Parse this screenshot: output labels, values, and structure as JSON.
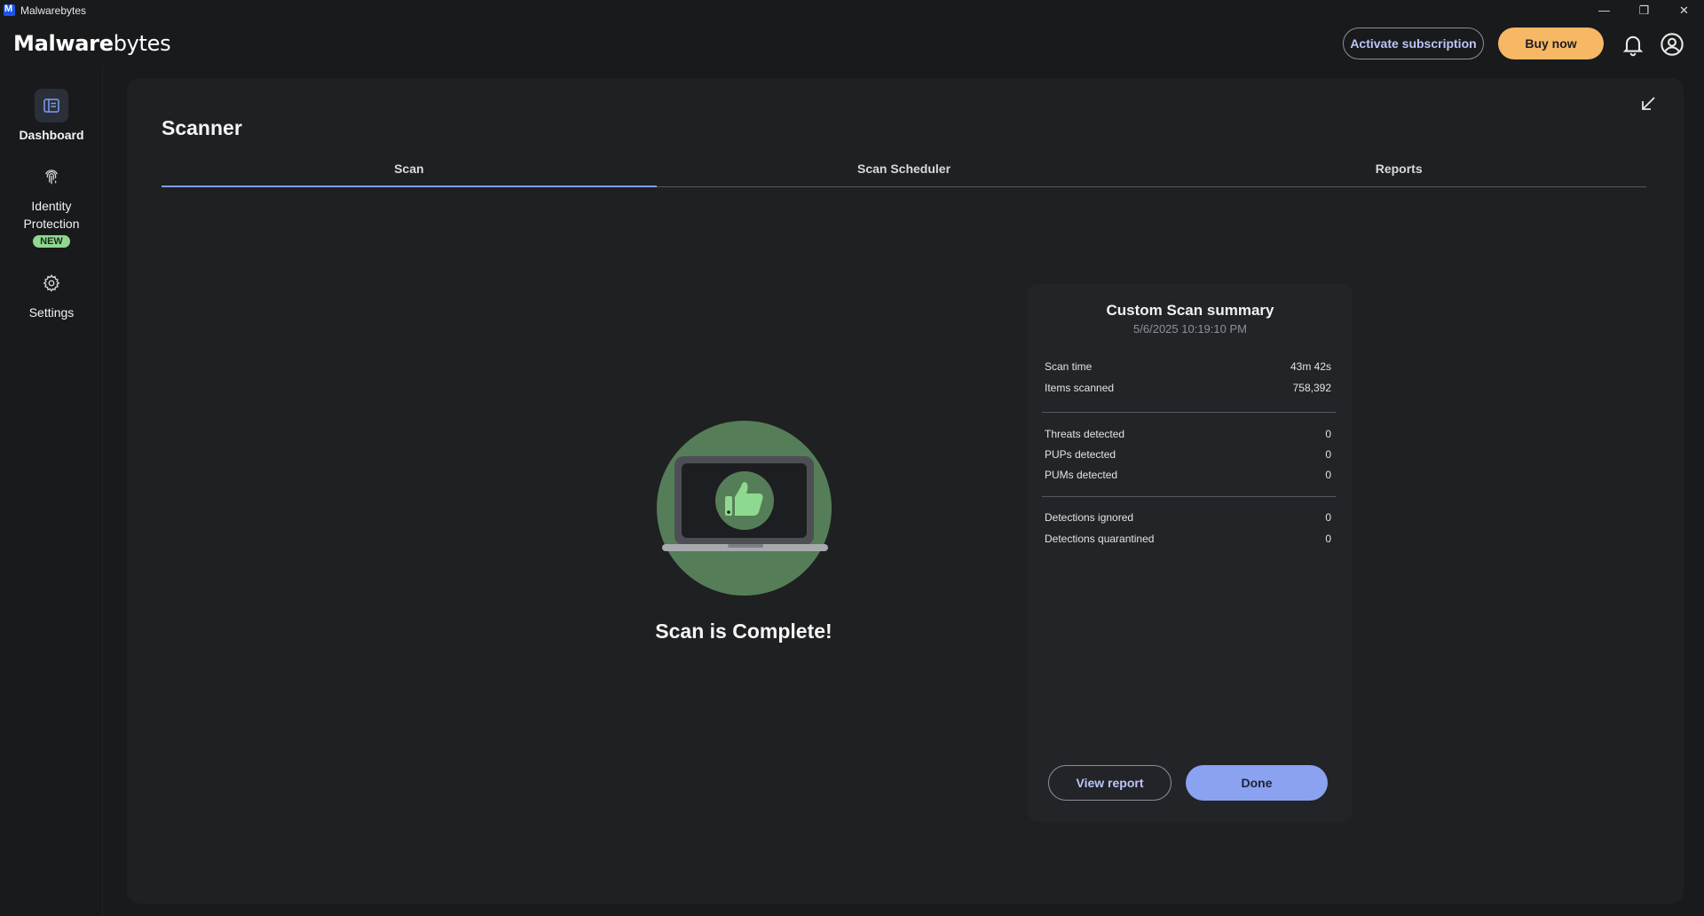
{
  "window": {
    "title": "Malwarebytes",
    "controls": {
      "minimize": "—",
      "restore": "❐",
      "close": "✕"
    }
  },
  "header": {
    "logo_bold": "Malware",
    "logo_light": "bytes",
    "activate_label": "Activate subscription",
    "buy_label": "Buy now",
    "icons": [
      "bell-icon",
      "account-icon"
    ]
  },
  "sidebar": {
    "items": [
      {
        "label": "Dashboard",
        "icon": "dashboard-icon",
        "active": true
      },
      {
        "label": "Identity Protection",
        "label_line1": "Identity",
        "label_line2": "Protection",
        "icon": "fingerprint-icon",
        "badge": "NEW"
      },
      {
        "label": "Settings",
        "icon": "gear-icon"
      }
    ]
  },
  "main": {
    "title": "Scanner",
    "tabs": [
      {
        "label": "Scan",
        "active": true
      },
      {
        "label": "Scan Scheduler"
      },
      {
        "label": "Reports"
      }
    ],
    "status": "Scan is Complete!"
  },
  "summary": {
    "title": "Custom Scan summary",
    "date": "5/6/2025 10:19:10 PM",
    "group1": [
      {
        "label": "Scan time",
        "value": "43m 42s"
      },
      {
        "label": "Items scanned",
        "value": "758,392"
      }
    ],
    "group2": [
      {
        "label": "Threats detected",
        "value": "0"
      },
      {
        "label": "PUPs detected",
        "value": "0"
      },
      {
        "label": "PUMs detected",
        "value": "0"
      }
    ],
    "group3": [
      {
        "label": "Detections ignored",
        "value": "0"
      },
      {
        "label": "Detections quarantined",
        "value": "0"
      }
    ],
    "view_report_label": "View report",
    "done_label": "Done"
  },
  "colors": {
    "accent": "#7d9ef0",
    "buy": "#f7b865",
    "success_circle": "#557e58",
    "badge": "#8fd890"
  }
}
